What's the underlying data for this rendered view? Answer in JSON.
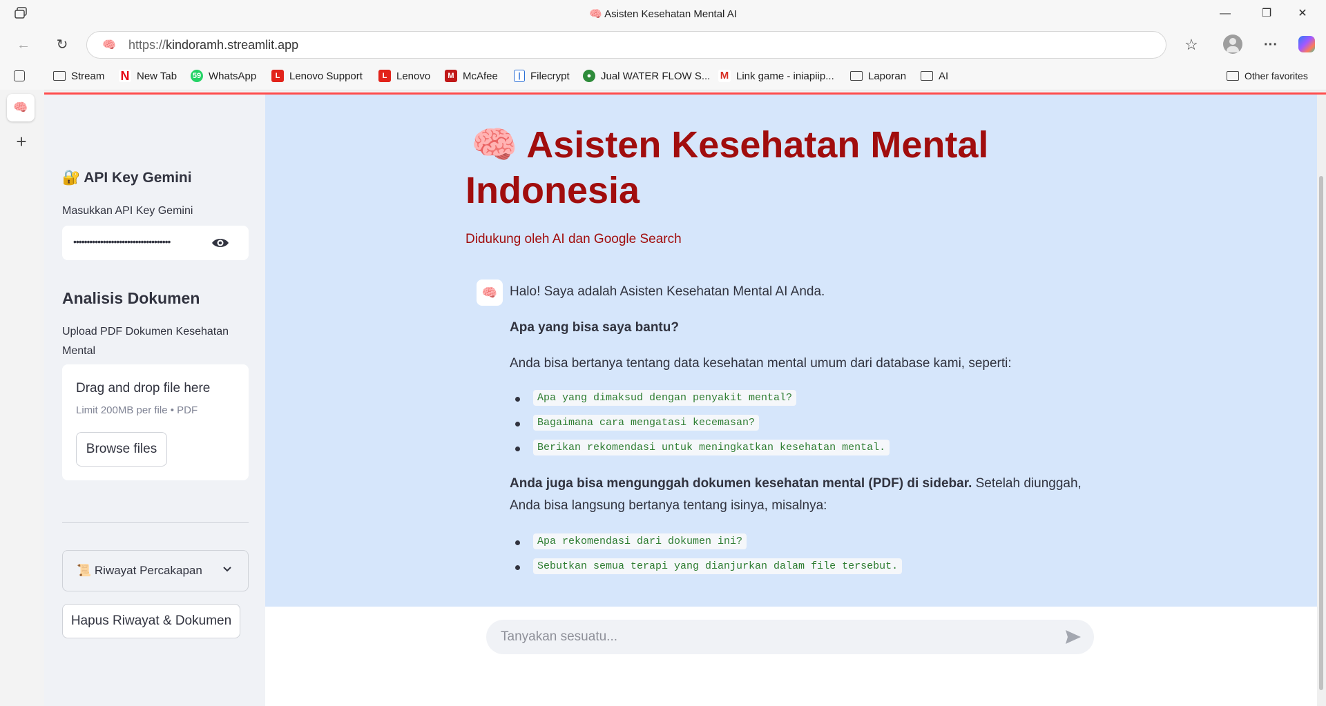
{
  "window": {
    "title": "Asisten Kesehatan Mental AI",
    "minimize": "—",
    "restore": "❐",
    "close": "✕"
  },
  "browser": {
    "url_protocol": "https://",
    "url_host": "kindoramh.streamlit.app",
    "back": "←",
    "reload": "↻",
    "favorites": "☆",
    "more": "···"
  },
  "bookmarks": [
    {
      "label": "Stream"
    },
    {
      "label": "New Tab"
    },
    {
      "label": "WhatsApp"
    },
    {
      "label": "Lenovo Support"
    },
    {
      "label": "Lenovo"
    },
    {
      "label": "McAfee"
    },
    {
      "label": "Filecrypt"
    },
    {
      "label": "Jual WATER FLOW S..."
    },
    {
      "label": "Link game - iniapiip..."
    },
    {
      "label": "Laporan"
    },
    {
      "label": "AI"
    }
  ],
  "other_favorites": "Other favorites",
  "sidebar": {
    "api_heading": "🔐 API Key Gemini",
    "api_label": "Masukkan API Key Gemini",
    "api_value": "••••••••••••••••••••••••••••••••••••",
    "doc_heading": "Analisis Dokumen",
    "upload_label": "Upload PDF Dokumen Kesehatan Mental",
    "drop_text": "Drag and drop file here",
    "drop_limit": "Limit 200MB per file • PDF",
    "browse_label": "Browse files",
    "history_label": "📜 Riwayat Percakapan",
    "clear_label": "Hapus Riwayat & Dokumen"
  },
  "main": {
    "title_line1": "🧠 Asisten Kesehatan Mental",
    "title_line2": "Indonesia",
    "subtitle": "Didukung oleh AI dan Google Search",
    "msg_intro": "Halo! Saya adalah Asisten Kesehatan Mental AI Anda.",
    "msg_q": "Apa yang bisa saya bantu?",
    "msg_p1": "Anda bisa bertanya tentang data kesehatan mental umum dari database kami, seperti:",
    "examples1": [
      "Apa yang dimaksud dengan penyakit mental?",
      "Bagaimana cara mengatasi kecemasan?",
      "Berikan rekomendasi untuk meningkatkan kesehatan mental."
    ],
    "msg_p2_bold": "Anda juga bisa mengunggah dokumen kesehatan mental (PDF) di sidebar.",
    "msg_p2_rest": " Setelah diunggah,",
    "msg_p2_line2": "Anda bisa langsung bertanya tentang isinya, misalnya:",
    "examples2": [
      "Apa rekomendasi dari dokumen ini?",
      "Sebutkan semua terapi yang dianjurkan dalam file tersebut."
    ]
  },
  "chat_input": {
    "placeholder": "Tanyakan sesuatu..."
  },
  "colors": {
    "accent": "#a10d0d",
    "streamlit_red": "#ff4b4b",
    "main_bg": "#d6e6fb",
    "sidebar_bg": "#f0f2f6"
  }
}
